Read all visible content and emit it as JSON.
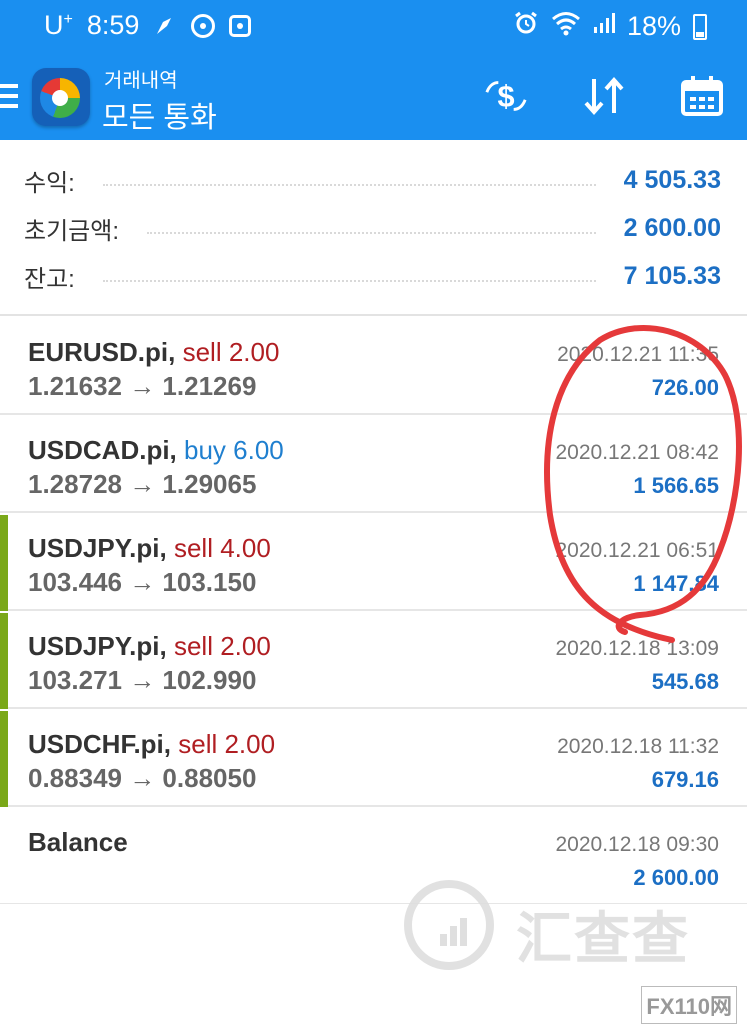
{
  "status_bar": {
    "carrier": "U",
    "carrier_sup": "+",
    "time": "8:59",
    "battery": "18%"
  },
  "app_bar": {
    "subtitle": "거래내역",
    "title": "모든 통화",
    "icons": [
      "menu-icon",
      "app-logo",
      "currency-exchange-icon",
      "sort-icon",
      "calendar-icon"
    ]
  },
  "summary": {
    "profit_label": "수익:",
    "profit_value": "4 505.33",
    "deposit_label": "초기금액:",
    "deposit_value": "2 600.00",
    "balance_label": "잔고:",
    "balance_value": "7 105.33"
  },
  "deals": [
    {
      "symbol": "EURUSD.pi,",
      "direction": "sell 2.00",
      "type": "sell",
      "prices": "1.21632 → 1.21269",
      "time": "2020.12.21 11:35",
      "profit": "726.00",
      "bar": false
    },
    {
      "symbol": "USDCAD.pi,",
      "direction": "buy 6.00",
      "type": "buy",
      "prices": "1.28728 → 1.29065",
      "time": "2020.12.21 08:42",
      "profit": "1 566.65",
      "bar": false
    },
    {
      "symbol": "USDJPY.pi,",
      "direction": "sell 4.00",
      "type": "sell",
      "prices": "103.446 → 103.150",
      "time": "2020.12.21 06:51",
      "profit": "1 147.84",
      "bar": true
    },
    {
      "symbol": "USDJPY.pi,",
      "direction": "sell 2.00",
      "type": "sell",
      "prices": "103.271 → 102.990",
      "time": "2020.12.18 13:09",
      "profit": "545.68",
      "bar": true
    },
    {
      "symbol": "USDCHF.pi,",
      "direction": "sell 2.00",
      "type": "sell",
      "prices": "0.88349 → 0.88050",
      "time": "2020.12.18 11:32",
      "profit": "679.16",
      "bar": true
    },
    {
      "symbol": "Balance",
      "direction": "",
      "type": "balance",
      "prices": "",
      "time": "2020.12.18 09:30",
      "profit": "2 600.00",
      "bar": false
    }
  ],
  "watermark": {
    "text": "汇查查",
    "brand": "FX110网"
  },
  "colors": {
    "primary": "#1a8ff0",
    "sell": "#b01e22",
    "buy": "#1f7fcf",
    "value": "#1c6fc4",
    "bar": "#7aa819",
    "annotation": "#e5393a"
  }
}
